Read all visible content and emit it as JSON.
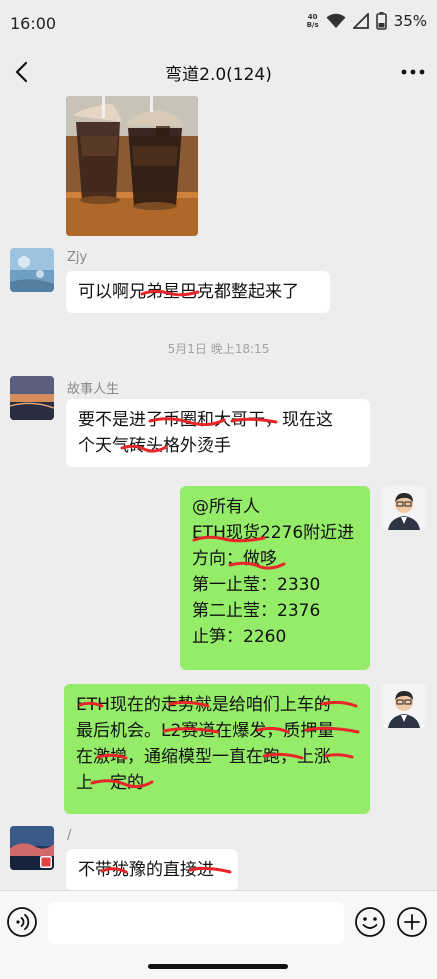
{
  "status_bar": {
    "time": "16:00",
    "net_speed_value": "40",
    "net_speed_unit": "B/s",
    "battery": "35%"
  },
  "header": {
    "title": "弯道2.0(124)"
  },
  "messages": [
    {
      "type": "image",
      "direction": "incoming",
      "alt": "coffee-photo"
    },
    {
      "type": "text",
      "direction": "incoming",
      "sender": "Zjy",
      "lines": [
        "可以啊兄弟星巴克都整起来了"
      ]
    },
    {
      "type": "time",
      "text": "5月1日 晚上18:15"
    },
    {
      "type": "text",
      "direction": "incoming",
      "sender": "故事人生",
      "lines": [
        "要不是进了币圈和大哥干，现在这",
        "个天气砖头格外烫手"
      ]
    },
    {
      "type": "text",
      "direction": "outgoing",
      "lines": [
        "@所有人",
        "ETH现货2276附近进",
        "方向：做哆",
        "第一止莹：2330",
        "第二止莹：2376",
        "止笋：2260"
      ]
    },
    {
      "type": "text",
      "direction": "outgoing",
      "lines": [
        "ETH现在的走势就是给咱们上车的",
        "最后机会。L2赛道在爆发，质押量",
        "在激增，通缩模型一直在跑，上涨",
        "上一定的"
      ]
    },
    {
      "type": "text",
      "direction": "incoming",
      "sender": "/",
      "lines": [
        "不带犹豫的直接进"
      ]
    }
  ],
  "input": {
    "value": ""
  },
  "icons": {
    "back": "chevron-left-icon",
    "more": "more-dots-icon",
    "voice": "voice-icon",
    "emoji": "emoji-icon",
    "plus": "plus-icon"
  },
  "colors": {
    "background": "#ededed",
    "incoming_bubble": "#ffffff",
    "outgoing_bubble": "#95ec69",
    "scribble": "#e8262a"
  }
}
